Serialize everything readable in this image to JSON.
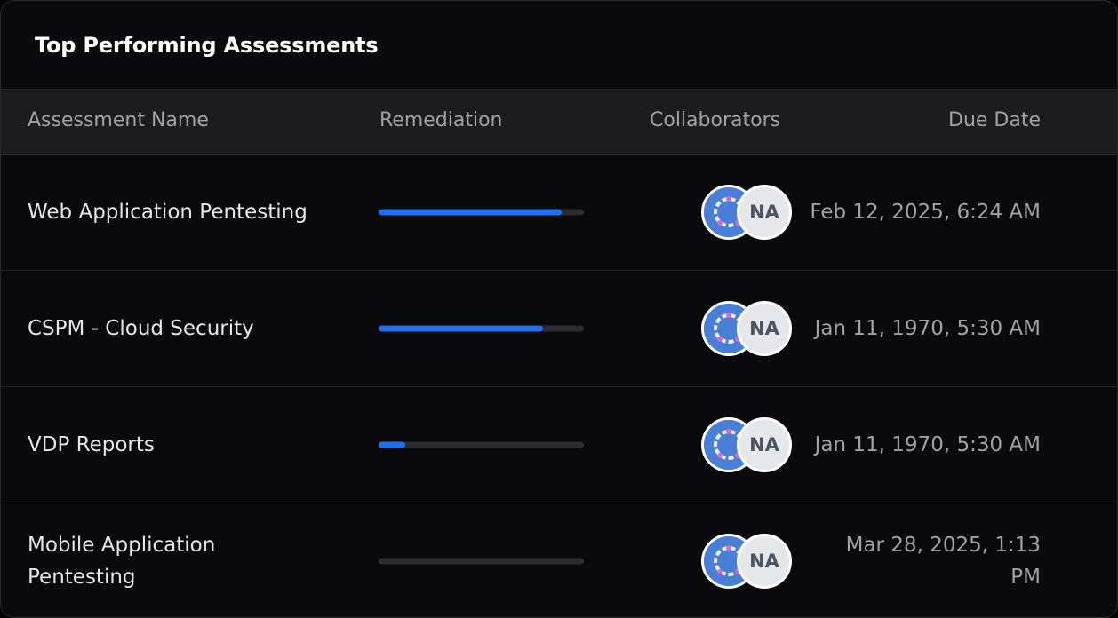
{
  "card": {
    "title": "Top Performing Assessments"
  },
  "table": {
    "headers": {
      "name": "Assessment Name",
      "remediation": "Remediation",
      "collaborators": "Collaborators",
      "due_date": "Due Date"
    },
    "rows": [
      {
        "name": "Web Application Pentesting",
        "remediation_fraction": 0.89,
        "avatar_initials": "NA",
        "due_date": "Feb 12, 2025, 6:24 AM"
      },
      {
        "name": "CSPM - Cloud Security",
        "remediation_fraction": 0.8,
        "avatar_initials": "NA",
        "due_date": "Jan 11, 1970, 5:30 AM"
      },
      {
        "name": "VDP Reports",
        "remediation_fraction": 0.13,
        "avatar_initials": "NA",
        "due_date": "Jan 11, 1970, 5:30 AM"
      },
      {
        "name": "Mobile Application Pentesting",
        "remediation_fraction": 0.0,
        "avatar_initials": "NA",
        "due_date": "Mar 28, 2025, 1:13 PM"
      }
    ]
  },
  "colors": {
    "progress_fill": "#1f6ff0",
    "progress_track": "#2c2c30",
    "background": "#0a0a0c",
    "header_row": "#1c1c1e"
  }
}
